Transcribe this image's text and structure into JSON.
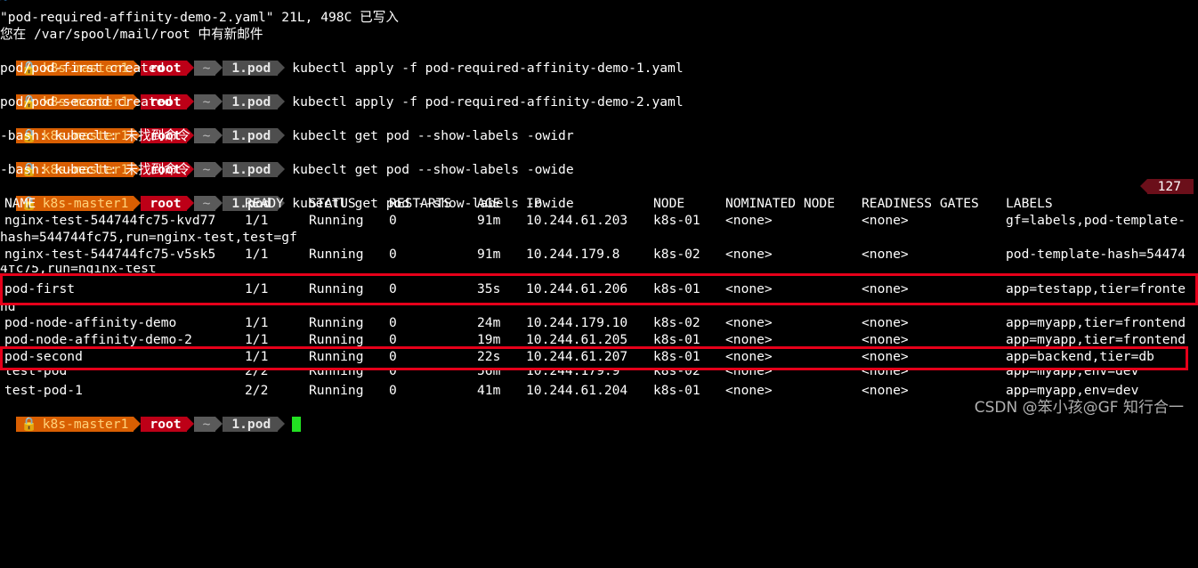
{
  "top_fragment": "~",
  "written_line": "\"pod-required-affinity-demo-2.yaml\" 21L, 498C 已写入",
  "mail_line": "您在 /var/spool/mail/root 中有新邮件",
  "prompt": {
    "lock_icon": "lock-icon",
    "host": "k8s-master1",
    "user": "root",
    "tilde": "~",
    "dir": "1.pod",
    "colors": {
      "host": "#d95f02",
      "user": "#bd0017",
      "tilde": "#5a5a5a",
      "dir": "#4e4e4e",
      "cursor": "#22e022"
    }
  },
  "commands": [
    "kubectl apply -f pod-required-affinity-demo-1.yaml",
    "kubectl apply -f pod-required-affinity-demo-2.yaml",
    "kubeclt get pod --show-labels -owidr",
    "kubeclt get pod --show-labels -owide",
    "kubectl get pod --show-labels -owide"
  ],
  "outputs": [
    "pod/pod-first created",
    "pod/pod-second created",
    "-bash: kubeclt: 未找到命令",
    "-bash: kubeclt: 未找到命令"
  ],
  "exit_code": "127",
  "table": {
    "headers": [
      "NAME",
      "READY",
      "STATUS",
      "RESTARTS",
      "AGE",
      "IP",
      "NODE",
      "NOMINATED NODE",
      "READINESS GATES",
      "LABELS"
    ],
    "rows": [
      [
        "nginx-test-544744fc75-kvd77",
        "1/1",
        "Running",
        "0",
        "91m",
        "10.244.61.203",
        "k8s-01",
        "<none>",
        "<none>",
        "gf=labels,pod-template-"
      ],
      [
        "nginx-test-544744fc75-v5sk5",
        "1/1",
        "Running",
        "0",
        "91m",
        "10.244.179.8",
        "k8s-02",
        "<none>",
        "<none>",
        "pod-template-hash=54474"
      ],
      [
        "pod-first",
        "1/1",
        "Running",
        "0",
        "35s",
        "10.244.61.206",
        "k8s-01",
        "<none>",
        "<none>",
        "app=testapp,tier=fronte"
      ],
      [
        "pod-node-affinity-demo",
        "1/1",
        "Running",
        "0",
        "24m",
        "10.244.179.10",
        "k8s-02",
        "<none>",
        "<none>",
        "app=myapp,tier=frontend"
      ],
      [
        "pod-node-affinity-demo-2",
        "1/1",
        "Running",
        "0",
        "19m",
        "10.244.61.205",
        "k8s-01",
        "<none>",
        "<none>",
        "app=myapp,tier=frontend"
      ],
      [
        "pod-second",
        "1/1",
        "Running",
        "0",
        "22s",
        "10.244.61.207",
        "k8s-01",
        "<none>",
        "<none>",
        "app=backend,tier=db"
      ],
      [
        "test-pod",
        "2/2",
        "Running",
        "0",
        "56m",
        "10.244.179.9",
        "k8s-02",
        "<none>",
        "<none>",
        "app=myapp,env=dev"
      ],
      [
        "test-pod-1",
        "2/2",
        "Running",
        "0",
        "41m",
        "10.244.61.204",
        "k8s-01",
        "<none>",
        "<none>",
        "app=myapp,env=dev"
      ]
    ],
    "wraps": [
      "hash=544744fc75,run=nginx-test,test=gf",
      "4fc75,run=nginx-test",
      "nd"
    ]
  },
  "highlight_color": "#e6001a",
  "watermark": "CSDN @笨小孩@GF 知行合一"
}
